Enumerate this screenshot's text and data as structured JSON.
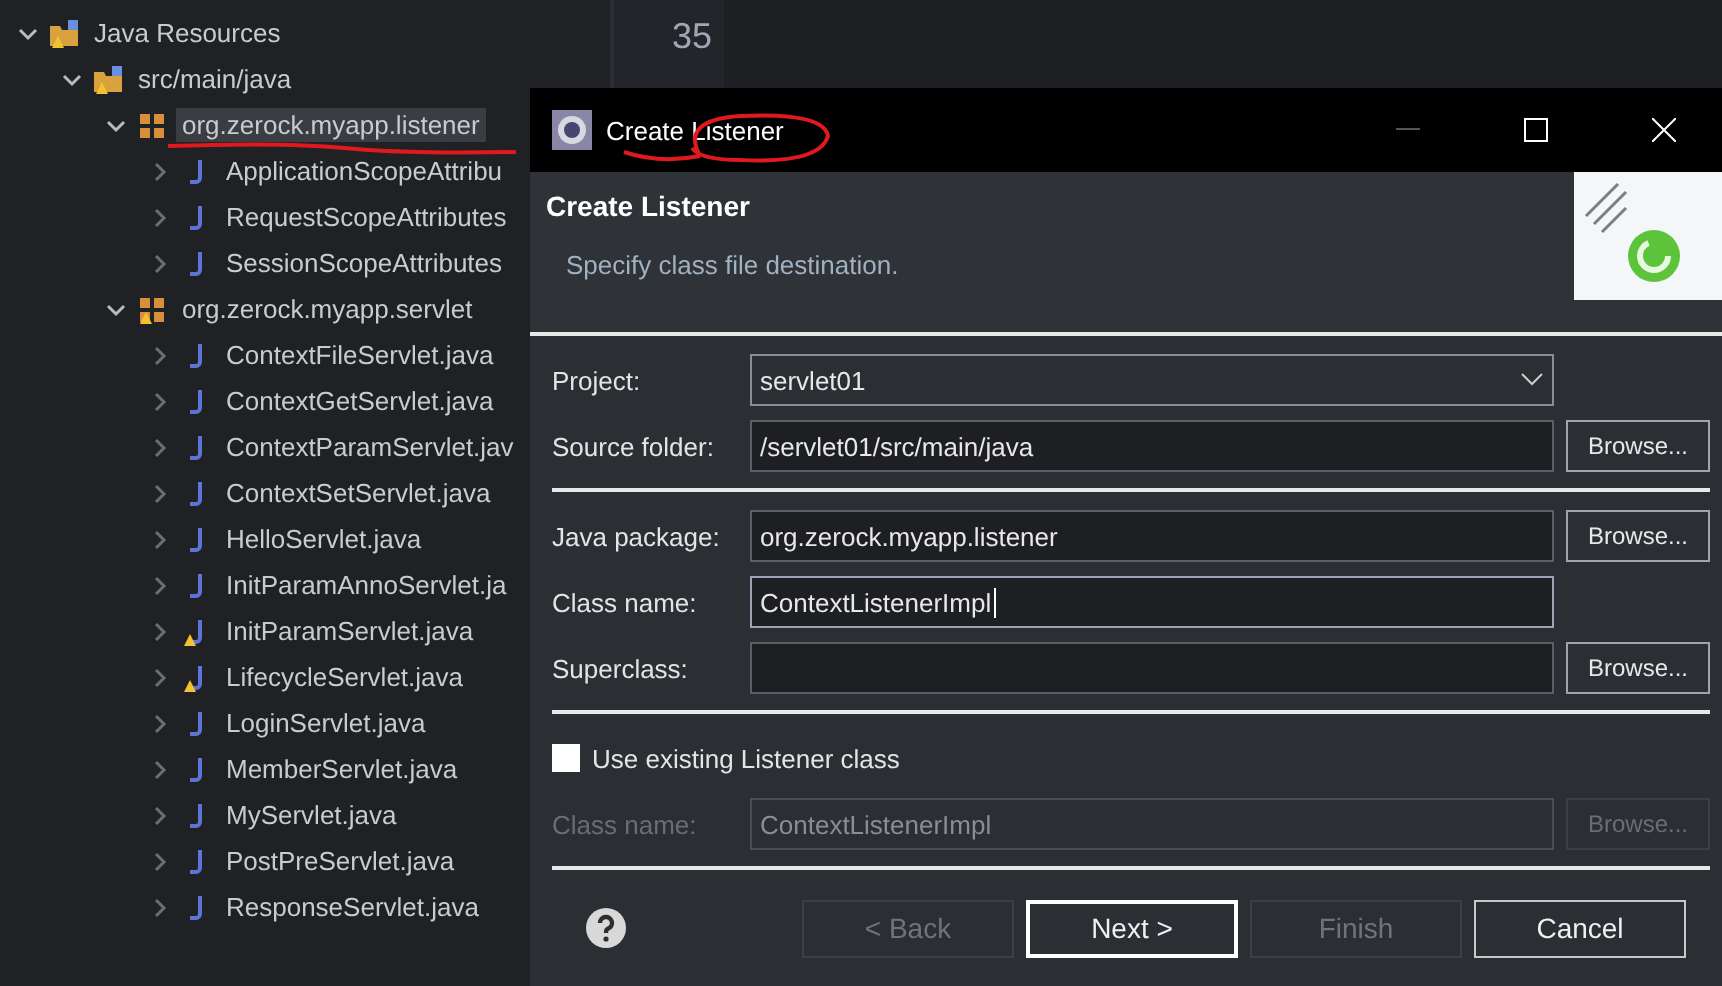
{
  "tree": [
    {
      "label": "Java Resources",
      "kind": "resources",
      "expanded": true,
      "warning": true,
      "selected": false,
      "children": [
        {
          "label": "src/main/java",
          "kind": "source-folder",
          "expanded": true,
          "warning": true,
          "selected": false,
          "children": [
            {
              "label": "org.zerock.myapp.listener",
              "kind": "package",
              "expanded": true,
              "warning": false,
              "selected": true,
              "children": [
                {
                  "label": "ApplicationScopeAttribu",
                  "kind": "class",
                  "expanded": false,
                  "warning": false,
                  "selected": false
                },
                {
                  "label": "RequestScopeAttributes",
                  "kind": "class",
                  "expanded": false,
                  "warning": false,
                  "selected": false
                },
                {
                  "label": "SessionScopeAttributes",
                  "kind": "class",
                  "expanded": false,
                  "warning": false,
                  "selected": false
                }
              ]
            },
            {
              "label": "org.zerock.myapp.servlet",
              "kind": "package",
              "expanded": true,
              "warning": true,
              "selected": false,
              "children": [
                {
                  "label": "ContextFileServlet.java",
                  "kind": "class",
                  "expanded": false,
                  "warning": false,
                  "selected": false
                },
                {
                  "label": "ContextGetServlet.java",
                  "kind": "class",
                  "expanded": false,
                  "warning": false,
                  "selected": false
                },
                {
                  "label": "ContextParamServlet.jav",
                  "kind": "class",
                  "expanded": false,
                  "warning": false,
                  "selected": false
                },
                {
                  "label": "ContextSetServlet.java",
                  "kind": "class",
                  "expanded": false,
                  "warning": false,
                  "selected": false
                },
                {
                  "label": "HelloServlet.java",
                  "kind": "class",
                  "expanded": false,
                  "warning": false,
                  "selected": false
                },
                {
                  "label": "InitParamAnnoServlet.ja",
                  "kind": "class",
                  "expanded": false,
                  "warning": false,
                  "selected": false
                },
                {
                  "label": "InitParamServlet.java",
                  "kind": "class",
                  "expanded": false,
                  "warning": true,
                  "selected": false
                },
                {
                  "label": "LifecycleServlet.java",
                  "kind": "class",
                  "expanded": false,
                  "warning": true,
                  "selected": false
                },
                {
                  "label": "LoginServlet.java",
                  "kind": "class",
                  "expanded": false,
                  "warning": false,
                  "selected": false
                },
                {
                  "label": "MemberServlet.java",
                  "kind": "class",
                  "expanded": false,
                  "warning": false,
                  "selected": false
                },
                {
                  "label": "MyServlet.java",
                  "kind": "class",
                  "expanded": false,
                  "warning": false,
                  "selected": false
                },
                {
                  "label": "PostPreServlet.java",
                  "kind": "class",
                  "expanded": false,
                  "warning": false,
                  "selected": false
                },
                {
                  "label": "ResponseServlet.java",
                  "kind": "class",
                  "expanded": false,
                  "warning": false,
                  "selected": false
                }
              ]
            }
          ]
        }
      ]
    }
  ],
  "editor": {
    "line_numbers": [
      "35"
    ]
  },
  "dialog": {
    "title": "Create Listener",
    "heading": "Create Listener",
    "description": "Specify class file destination.",
    "sections": [
      [
        {
          "kind": "combo",
          "label": "Project:",
          "value": "servlet01"
        },
        {
          "kind": "text",
          "label": "Source folder:",
          "value": "/servlet01/src/main/java",
          "button": "Browse...",
          "disabled": false,
          "focused": false
        }
      ],
      [
        {
          "kind": "text",
          "label": "Java package:",
          "value": "org.zerock.myapp.listener",
          "button": "Browse...",
          "disabled": false,
          "focused": false
        },
        {
          "kind": "text",
          "label": "Class name:",
          "value": "ContextListenerImpl",
          "disabled": false,
          "focused": true
        },
        {
          "kind": "text",
          "label": "Superclass:",
          "button": "Browse...",
          "disabled": false,
          "focused": false
        }
      ],
      [
        {
          "kind": "checkbox",
          "label": "Use existing Listener class",
          "checked": false
        },
        {
          "kind": "text",
          "label": "Class name:",
          "value": "ContextListenerImpl",
          "button": "Browse...",
          "disabled": true,
          "focused": false
        }
      ]
    ],
    "buttons": [
      {
        "label": "< Back",
        "disabled": true,
        "default": false
      },
      {
        "label": "Next >",
        "disabled": false,
        "default": true
      },
      {
        "label": "Finish",
        "disabled": true,
        "default": false
      },
      {
        "label": "Cancel",
        "disabled": false,
        "default": false
      }
    ]
  }
}
